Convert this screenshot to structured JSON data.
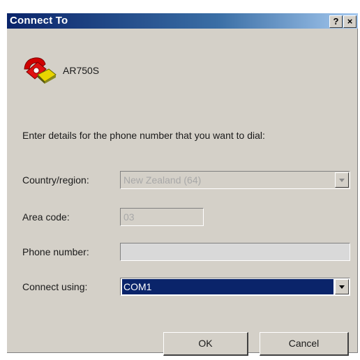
{
  "window": {
    "title": "Connect To",
    "help_label": "?",
    "close_label": "×"
  },
  "device": {
    "name": "AR750S",
    "icon": "phone-icon"
  },
  "instructions": "Enter details for the phone number that you want to dial:",
  "form": {
    "country": {
      "label": "Country/region:",
      "value": "New Zealand (64)",
      "enabled": false
    },
    "area_code": {
      "label": "Area code:",
      "value": "03",
      "enabled": false
    },
    "phone_number": {
      "label": "Phone number:",
      "value": "",
      "enabled": true
    },
    "connect_using": {
      "label": "Connect using:",
      "value": "COM1",
      "selected": true
    }
  },
  "buttons": {
    "ok": "OK",
    "cancel": "Cancel"
  },
  "colors": {
    "titlebar_start": "#0a246a",
    "titlebar_end": "#a6caf0",
    "dialog_bg": "#d4d0c8",
    "selection": "#0a246a"
  }
}
